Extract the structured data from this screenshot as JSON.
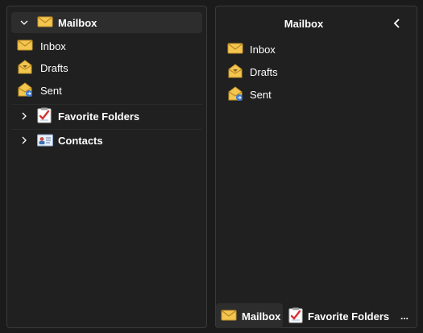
{
  "left": {
    "mailbox": {
      "label": "Mailbox",
      "icon": "envelope-icon",
      "expanded": true
    },
    "items": [
      {
        "label": "Inbox",
        "icon": "inbox-envelope-icon"
      },
      {
        "label": "Drafts",
        "icon": "drafts-envelope-icon"
      },
      {
        "label": "Sent",
        "icon": "sent-envelope-icon"
      }
    ],
    "favorites": {
      "label": "Favorite Folders",
      "icon": "checklist-icon",
      "expanded": false
    },
    "contacts": {
      "label": "Contacts",
      "icon": "contact-card-icon",
      "expanded": false
    }
  },
  "right": {
    "title": "Mailbox",
    "back_icon": "chevron-left-icon",
    "items": [
      {
        "label": "Inbox",
        "icon": "inbox-envelope-icon"
      },
      {
        "label": "Drafts",
        "icon": "drafts-envelope-icon"
      },
      {
        "label": "Sent",
        "icon": "sent-envelope-icon"
      }
    ],
    "bottom_tabs": [
      {
        "label": "Mailbox",
        "icon": "envelope-icon",
        "active": true
      },
      {
        "label": "Favorite Folders",
        "icon": "checklist-icon",
        "active": false
      }
    ],
    "more_label": "..."
  },
  "colors": {
    "background": "#1b1b1b",
    "panel": "#202020",
    "selected": "#2d2d2d",
    "envelope": "#f2c14e"
  }
}
